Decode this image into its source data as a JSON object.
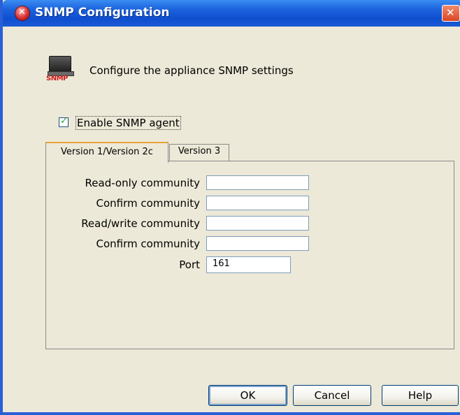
{
  "window": {
    "title": "SNMP Configuration"
  },
  "header": {
    "icon_label": "SNMP",
    "text": "Configure the appliance SNMP settings"
  },
  "enable_agent": {
    "label": "Enable SNMP agent",
    "checked": true
  },
  "tabs": [
    {
      "label": "Version 1/Version 2c",
      "active": true
    },
    {
      "label": "Version 3",
      "active": false
    }
  ],
  "fields": {
    "read_only_community": {
      "label": "Read-only community",
      "value": ""
    },
    "confirm_community_1": {
      "label": "Confirm community",
      "value": ""
    },
    "read_write_community": {
      "label": "Read/write community",
      "value": ""
    },
    "confirm_community_2": {
      "label": "Confirm community",
      "value": ""
    },
    "port": {
      "label": "Port",
      "value": "161"
    }
  },
  "buttons": {
    "ok": "OK",
    "cancel": "Cancel",
    "help": "Help"
  },
  "colors": {
    "titlebar": "#0f4fcf",
    "dialog_bg": "#ece9d8",
    "checkmark": "#21a121",
    "snmp_icon_text": "#cc1d1d"
  },
  "icons": {
    "app": "app-close-logo-icon",
    "close": "close-icon",
    "header": "snmp-computer-icon",
    "check": "checkmark-icon"
  }
}
